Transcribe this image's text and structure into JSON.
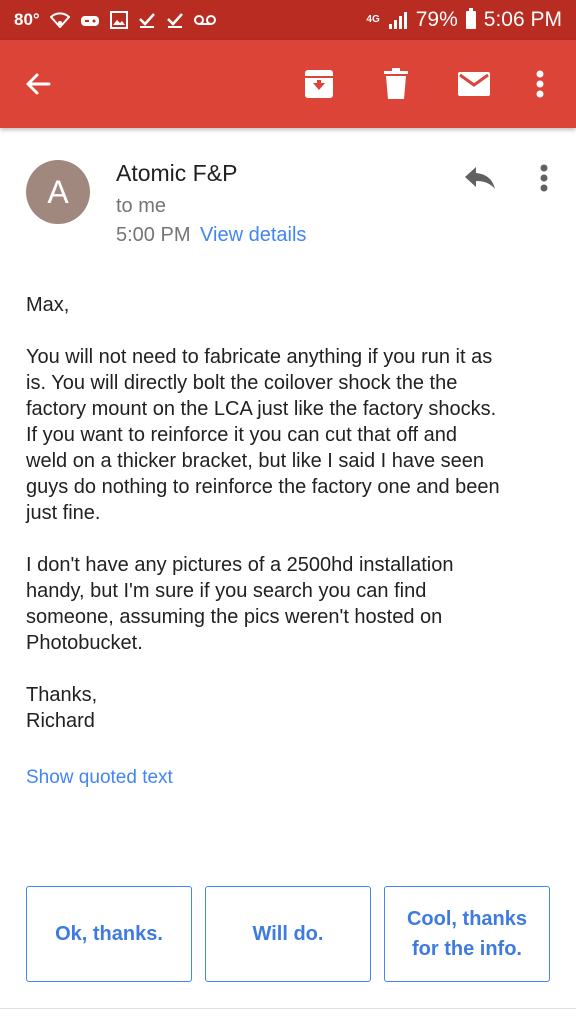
{
  "status_bar": {
    "temperature": "80°",
    "network": "4G",
    "battery": "79%",
    "time": "5:06 PM"
  },
  "toolbar": {
    "back_icon": "arrow-left-icon",
    "archive_icon": "archive-icon",
    "delete_icon": "trash-icon",
    "mail_icon": "mail-icon",
    "more_icon": "more-vert-icon"
  },
  "email": {
    "avatar_letter": "A",
    "sender": "Atomic F&P",
    "recipient": "to me",
    "time": "5:00 PM",
    "view_details": "View details",
    "body": [
      "Max,",
      "You will not need to fabricate anything if you run it as\nis. You will directly bolt the coilover shock the the\nfactory mount on the LCA just like the factory shocks.\nIf you want to reinforce it you can cut that off and\nweld on a thicker bracket, but like I said I have seen\nguys do nothing to reinforce the factory one and been\njust fine.",
      "I don't have any pictures of a 2500hd installation\nhandy, but I'm sure if you search you can find\nsomeone, assuming the pics weren't hosted on\nPhotobucket.",
      "Thanks,\nRichard"
    ],
    "show_quoted": "Show quoted text"
  },
  "smart_replies": [
    "Ok, thanks.",
    "Will do.",
    "Cool, thanks\nfor the info."
  ],
  "colors": {
    "status_bar": "#b92c22",
    "toolbar": "#db4437",
    "link": "#4285f4",
    "avatar": "#a1887f"
  }
}
